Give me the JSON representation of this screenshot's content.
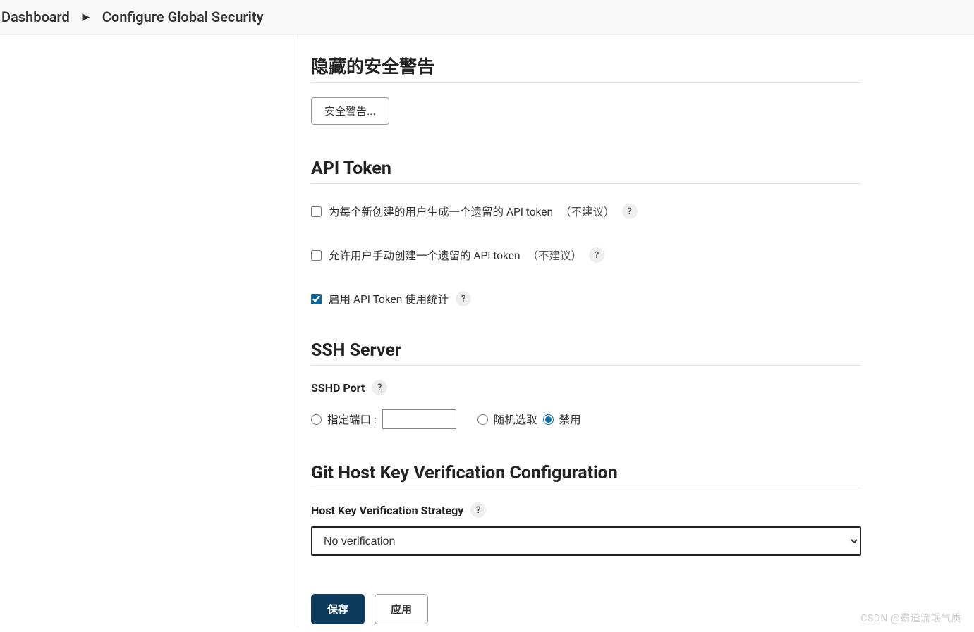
{
  "breadcrumb": {
    "dashboard": "Dashboard",
    "current": "Configure Global Security"
  },
  "sections": {
    "hidden_warnings": {
      "title": "隐藏的安全警告",
      "button": "安全警告..."
    },
    "api_token": {
      "title": "API Token",
      "opt1_label": "为每个新创建的用户生成一个遗留的 API token",
      "opt1_suffix": "（不建议）",
      "opt2_label": "允许用户手动创建一个遗留的 API token",
      "opt2_suffix": "（不建议）",
      "opt3_label": "启用 API Token 使用统计"
    },
    "ssh_server": {
      "title": "SSH Server",
      "port_label": "SSHD Port",
      "radio_specify": "指定端口 :",
      "radio_random": "随机选取",
      "radio_disable": "禁用"
    },
    "git_host": {
      "title": "Git Host Key Verification Configuration",
      "strategy_label": "Host Key Verification Strategy",
      "strategy_value": "No verification"
    }
  },
  "buttons": {
    "save": "保存",
    "apply": "应用"
  },
  "watermark": "CSDN @霸道流氓气质"
}
